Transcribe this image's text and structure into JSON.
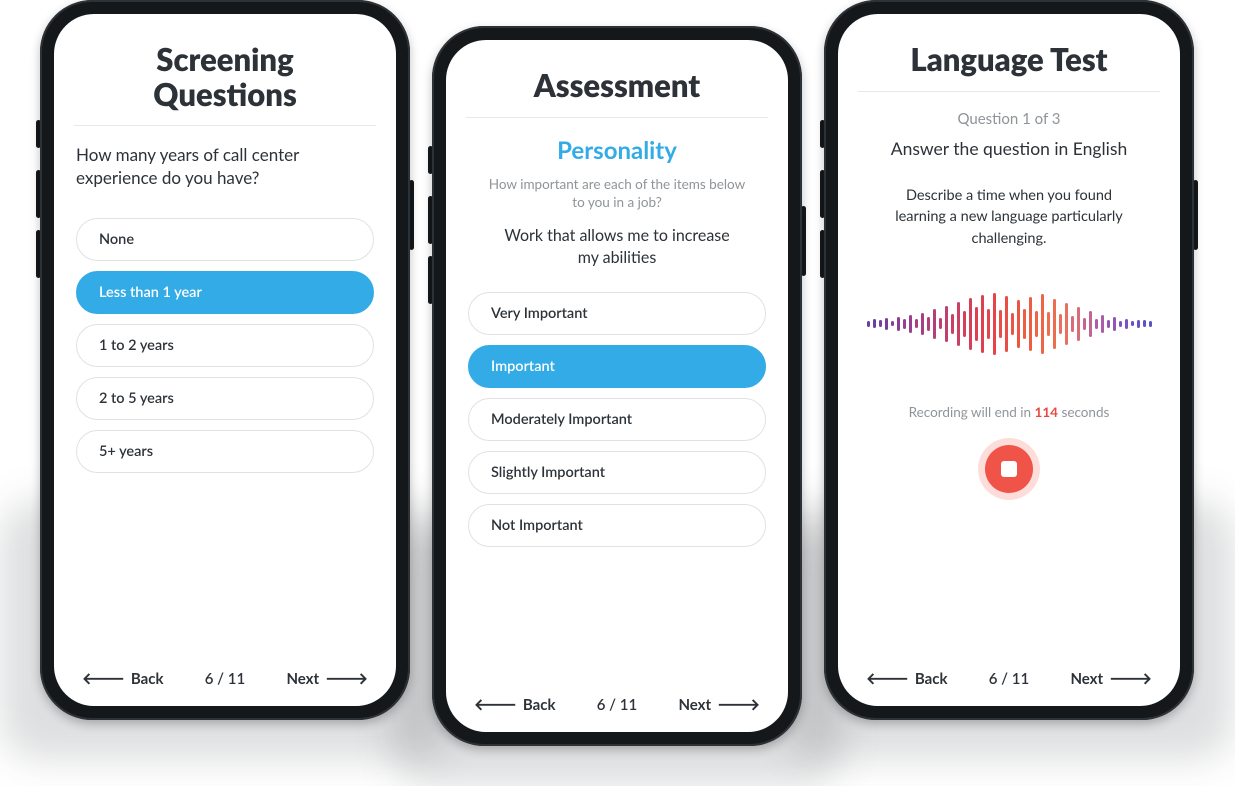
{
  "nav": {
    "back": "Back",
    "next": "Next",
    "page": "6 / 11"
  },
  "phone1": {
    "title_l1": "Screening",
    "title_l2": "Questions",
    "question": "How many years of call center experience do you have?",
    "options": [
      "None",
      "Less than 1 year",
      "1 to 2 years",
      "2 to 5 years",
      "5+ years"
    ],
    "selected": 1
  },
  "phone2": {
    "title": "Assessment",
    "section": "Personality",
    "lead": "How important are each of the items below to you in a job?",
    "statement": "Work that allows me to increase my abilities",
    "options": [
      "Very Important",
      "Important",
      "Moderately Important",
      "Slightly Important",
      "Not Important"
    ],
    "selected": 1
  },
  "phone3": {
    "title": "Language Test",
    "qcount": "Question 1 of 3",
    "instruction": "Answer the question in English",
    "prompt": "Describe a time when you found learning a new language particularly challenging.",
    "rec_prefix": "Recording will end in ",
    "rec_seconds": "114",
    "rec_suffix": " seconds",
    "wave_heights": [
      6,
      9,
      7,
      12,
      5,
      14,
      10,
      18,
      9,
      22,
      14,
      30,
      11,
      36,
      20,
      44,
      26,
      52,
      34,
      58,
      30,
      62,
      28,
      56,
      22,
      48,
      30,
      54,
      26,
      60,
      24,
      50,
      20,
      42,
      16,
      34,
      12,
      26,
      10,
      18,
      8,
      14,
      6,
      10,
      5,
      8,
      7,
      6
    ],
    "wave_colors": [
      "#6b3fa0",
      "#6b3fa0",
      "#7a3f9c",
      "#7a3f9c",
      "#8a3f94",
      "#8a3f94",
      "#9a3f8c",
      "#9a3f8c",
      "#a83f82",
      "#a83f82",
      "#b43f78",
      "#b43f78",
      "#c03f6e",
      "#c03f6e",
      "#cc3f62",
      "#cc3f62",
      "#d63f58",
      "#d63f58",
      "#df4050",
      "#df4050",
      "#e6444a",
      "#e6444a",
      "#ea4c46",
      "#ea4c46",
      "#ec5444",
      "#ec5444",
      "#ee5c44",
      "#ee5c44",
      "#ef6446",
      "#ef6446",
      "#ee6c50",
      "#ee6c50",
      "#e8705e",
      "#e8705e",
      "#d86c78",
      "#d86c78",
      "#c46490",
      "#c46490",
      "#ac5ca8",
      "#ac5ca8",
      "#9456b6",
      "#9456b6",
      "#7c52c0",
      "#7c52c0",
      "#6850c6",
      "#6850c6",
      "#5a52cc",
      "#5a52cc"
    ]
  }
}
